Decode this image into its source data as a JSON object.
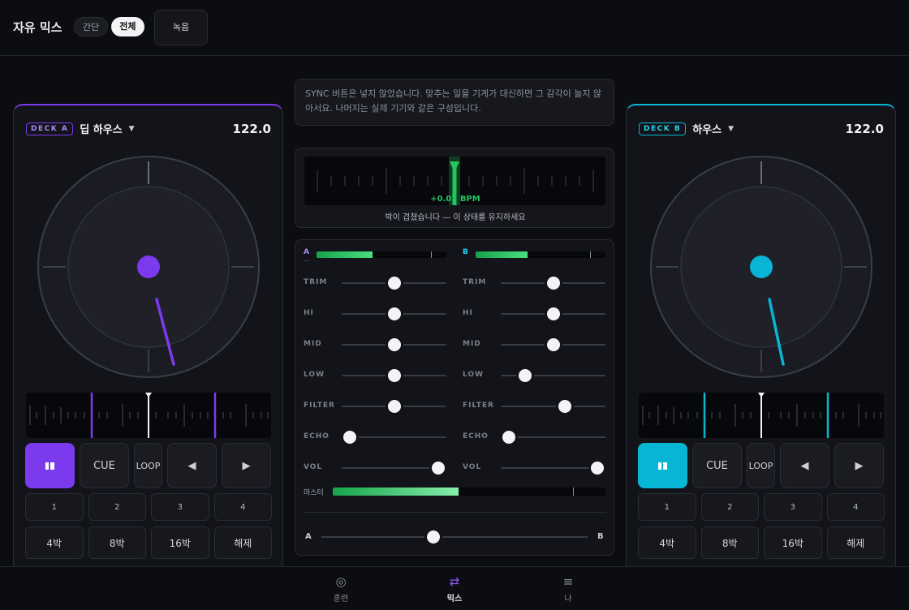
{
  "header": {
    "title": "자유 믹스",
    "mode_simple": "간단",
    "mode_full": "전체",
    "record": "녹음"
  },
  "note": "SYNC 버튼은 넣지 않았습니다. 맞추는 일을 기계가 대신하면 그 감각이 늘지 않아서요. 나머지는 실제 기기와 같은 구성입니다.",
  "beat": {
    "offset": "+0.02 BPM",
    "message": "박이 겹쳤습니다 — 이 상태를 유지하세요"
  },
  "colors": {
    "deck_a": "#7c3aed",
    "deck_b": "#06b6d4",
    "meter_green": "#22c55e"
  },
  "deckA": {
    "tag": "DECK A",
    "name": "딥 하우스",
    "bpm": "122.0",
    "play_icon": "pause-icon",
    "cue": "CUE",
    "loop": "LOOP",
    "prev_icon": "chevron-left-icon",
    "next_icon": "chevron-right-icon",
    "hotcues": [
      "1",
      "2",
      "3",
      "4"
    ],
    "loops": [
      "4박",
      "8박",
      "16박",
      "해제"
    ]
  },
  "deckB": {
    "tag": "DECK B",
    "name": "하우스",
    "bpm": "122.0",
    "play_icon": "pause-icon",
    "cue": "CUE",
    "loop": "LOOP",
    "prev_icon": "chevron-left-icon",
    "next_icon": "chevron-right-icon",
    "hotcues": [
      "1",
      "2",
      "3",
      "4"
    ],
    "loops": [
      "4박",
      "8박",
      "16박",
      "해제"
    ]
  },
  "mixer": {
    "chA": {
      "label": "A",
      "dash": "—",
      "level": 0.43,
      "peak": 0.88,
      "trim": 0.5,
      "hi": 0.5,
      "mid": 0.5,
      "low": 0.5,
      "filter": 0.5,
      "echo": 0.08,
      "vol": 0.92
    },
    "chB": {
      "label": "B",
      "dash": "",
      "level": 0.4,
      "peak": 0.88,
      "trim": 0.5,
      "hi": 0.5,
      "mid": 0.5,
      "low": 0.23,
      "filter": 0.61,
      "echo": 0.08,
      "vol": 0.92
    },
    "knob_labels": {
      "trim": "TRIM",
      "hi": "HI",
      "mid": "MID",
      "low": "LOW",
      "filter": "FILTER",
      "echo": "ECHO",
      "vol": "VOL"
    },
    "master_label": "마스터",
    "master_level": 0.46,
    "master_peak": 0.88,
    "xfader_a": "A",
    "xfader_b": "B",
    "crossfader": 0.42
  },
  "nav": {
    "items": [
      {
        "label": "훈련",
        "icon": "target-icon"
      },
      {
        "label": "믹스",
        "icon": "swap-icon"
      },
      {
        "label": "나",
        "icon": "menu-icon"
      }
    ]
  }
}
